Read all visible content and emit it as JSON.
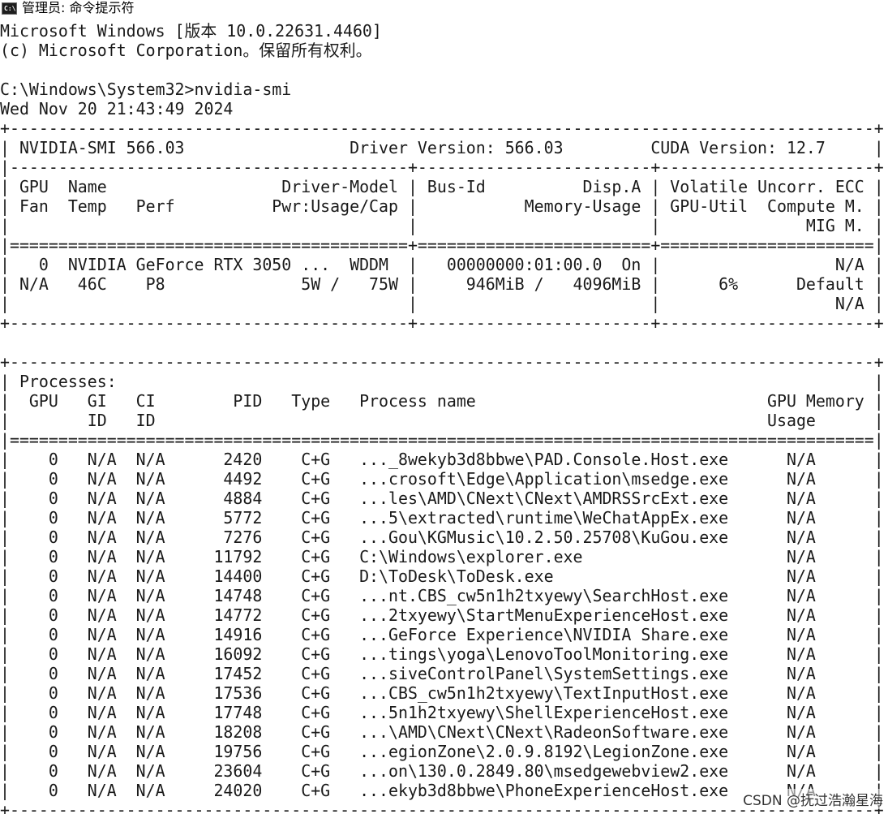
{
  "window": {
    "icon": "cmd-icon",
    "icon_glyph": "C:\\",
    "title": "管理员: 命令提示符"
  },
  "console": {
    "lines": [
      "Microsoft Windows [版本 10.0.22631.4460]",
      "(c) Microsoft Corporation。保留所有权利。",
      "",
      "C:\\Windows\\System32>nvidia-smi",
      "Wed Nov 20 21:43:49 2024",
      "+-----------------------------------------------------------------------------------------+",
      "| NVIDIA-SMI 566.03                 Driver Version: 566.03         CUDA Version: 12.7     |",
      "|-----------------------------------------+------------------------+----------------------+",
      "| GPU  Name                  Driver-Model | Bus-Id          Disp.A | Volatile Uncorr. ECC |",
      "| Fan  Temp   Perf          Pwr:Usage/Cap |           Memory-Usage | GPU-Util  Compute M. |",
      "|                                         |                        |               MIG M. |",
      "|=========================================+========================+======================|",
      "|   0  NVIDIA GeForce RTX 3050 ...  WDDM  |   00000000:01:00.0  On |                  N/A |",
      "| N/A   46C    P8              5W /   75W |     946MiB /   4096MiB |      6%      Default |",
      "|                                         |                        |                  N/A |",
      "+-----------------------------------------+------------------------+----------------------+",
      "",
      "+-----------------------------------------------------------------------------------------+",
      "| Processes:                                                                              |",
      "|  GPU   GI   CI        PID   Type   Process name                              GPU Memory |",
      "|        ID   ID                                                               Usage      |",
      "|=========================================================================================|",
      "|    0   N/A  N/A      2420    C+G   ..._8wekyb3d8bbwe\\PAD.Console.Host.exe      N/A      |",
      "|    0   N/A  N/A      4492    C+G   ...crosoft\\Edge\\Application\\msedge.exe      N/A      |",
      "|    0   N/A  N/A      4884    C+G   ...les\\AMD\\CNext\\CNext\\AMDRSSrcExt.exe      N/A      |",
      "|    0   N/A  N/A      5772    C+G   ...5\\extracted\\runtime\\WeChatAppEx.exe      N/A      |",
      "|    0   N/A  N/A      7276    C+G   ...Gou\\KGMusic\\10.2.50.25708\\KuGou.exe      N/A      |",
      "|    0   N/A  N/A     11792    C+G   C:\\Windows\\explorer.exe                     N/A      |",
      "|    0   N/A  N/A     14400    C+G   D:\\ToDesk\\ToDesk.exe                        N/A      |",
      "|    0   N/A  N/A     14748    C+G   ...nt.CBS_cw5n1h2txyewy\\SearchHost.exe      N/A      |",
      "|    0   N/A  N/A     14772    C+G   ...2txyewy\\StartMenuExperienceHost.exe      N/A      |",
      "|    0   N/A  N/A     14916    C+G   ...GeForce Experience\\NVIDIA Share.exe      N/A      |",
      "|    0   N/A  N/A     16092    C+G   ...tings\\yoga\\LenovoToolMonitoring.exe      N/A      |",
      "|    0   N/A  N/A     17452    C+G   ...siveControlPanel\\SystemSettings.exe      N/A      |",
      "|    0   N/A  N/A     17536    C+G   ...CBS_cw5n1h2txyewy\\TextInputHost.exe      N/A      |",
      "|    0   N/A  N/A     17748    C+G   ...5n1h2txyewy\\ShellExperienceHost.exe      N/A      |",
      "|    0   N/A  N/A     18208    C+G   ...\\AMD\\CNext\\CNext\\RadeonSoftware.exe      N/A      |",
      "|    0   N/A  N/A     19756    C+G   ...egionZone\\2.0.9.8192\\LegionZone.exe      N/A      |",
      "|    0   N/A  N/A     23604    C+G   ...on\\130.0.2849.80\\msedgewebview2.exe      N/A      |",
      "|    0   N/A  N/A     24020    C+G   ...ekyb3d8bbwe\\PhoneExperienceHost.exe      N/A      |",
      "+-----------------------------------------------------------------------------------------+"
    ]
  },
  "watermark": "CSDN @抚过浩瀚星海"
}
